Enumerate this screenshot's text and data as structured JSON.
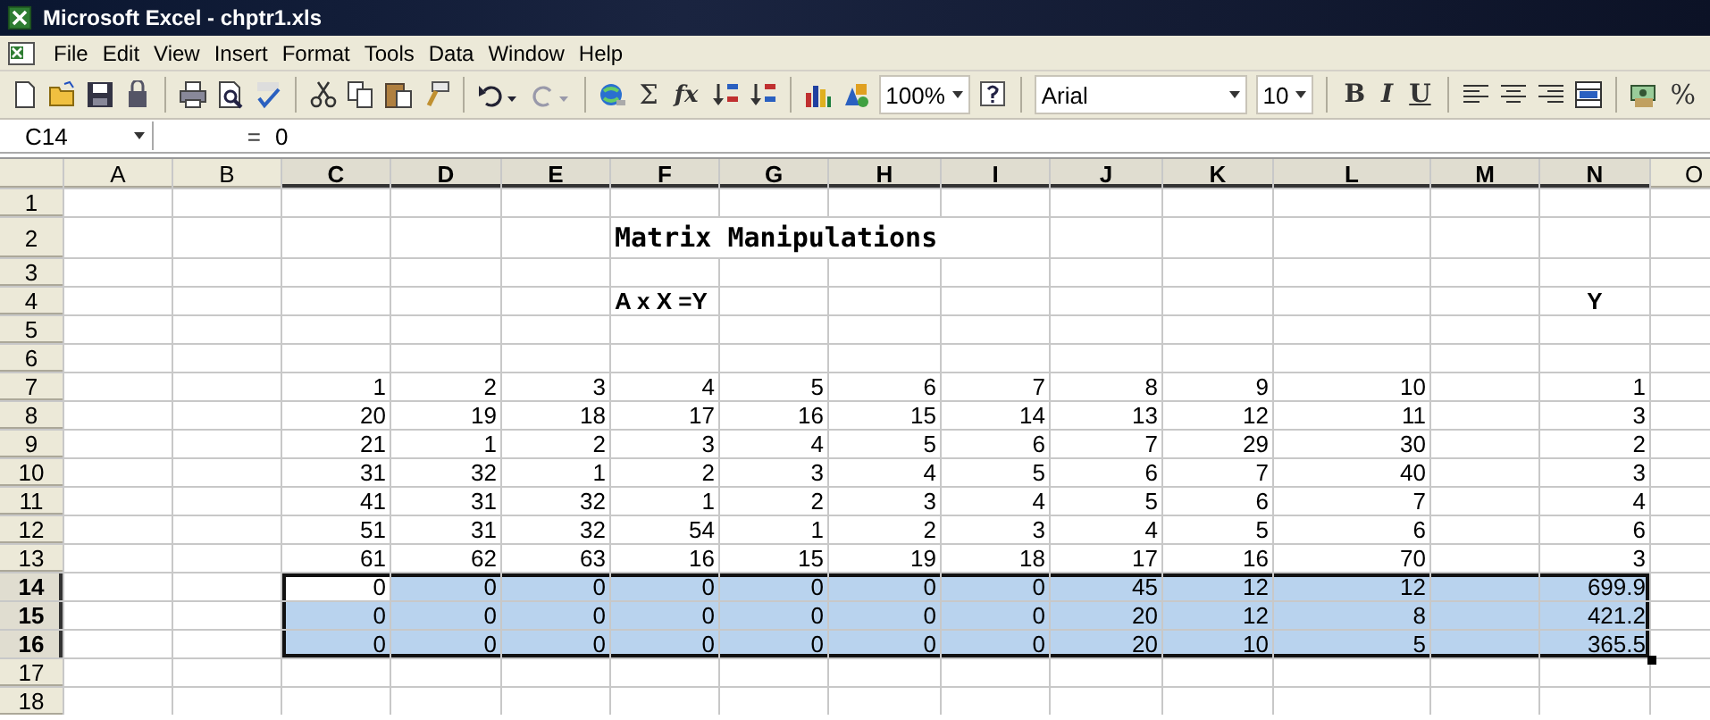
{
  "window": {
    "title": "Microsoft Excel - chptr1.xls"
  },
  "menu": [
    "File",
    "Edit",
    "View",
    "Insert",
    "Format",
    "Tools",
    "Data",
    "Window",
    "Help"
  ],
  "toolbar": [
    {
      "kind": "new"
    },
    {
      "kind": "open"
    },
    {
      "kind": "save"
    },
    {
      "kind": "permission"
    },
    {
      "kind": "separator"
    },
    {
      "kind": "print"
    },
    {
      "kind": "preview"
    },
    {
      "kind": "spelling"
    },
    {
      "kind": "separator"
    },
    {
      "kind": "cut"
    },
    {
      "kind": "copy"
    },
    {
      "kind": "paste"
    },
    {
      "kind": "painter"
    },
    {
      "kind": "separator"
    },
    {
      "kind": "undo"
    },
    {
      "kind": "redo"
    },
    {
      "kind": "separator"
    },
    {
      "kind": "hyperlink"
    },
    {
      "kind": "glyph",
      "text": "Σ"
    },
    {
      "kind": "function",
      "text": "fx"
    },
    {
      "kind": "sort-asc"
    },
    {
      "kind": "sort-desc"
    },
    {
      "kind": "separator"
    },
    {
      "kind": "chart"
    },
    {
      "kind": "drawing"
    },
    {
      "kind": "dropdown",
      "text": "100%"
    },
    {
      "kind": "help"
    },
    {
      "kind": "separator"
    },
    {
      "kind": "font",
      "text": "Arial"
    },
    {
      "kind": "dropdown",
      "text": "10"
    },
    {
      "kind": "separator"
    },
    {
      "kind": "bold",
      "text": "B"
    },
    {
      "kind": "italic",
      "text": "I"
    },
    {
      "kind": "underline",
      "text": "U"
    },
    {
      "kind": "separator"
    },
    {
      "kind": "align-left"
    },
    {
      "kind": "align-center"
    },
    {
      "kind": "align-right"
    },
    {
      "kind": "merge"
    },
    {
      "kind": "separator"
    },
    {
      "kind": "currency"
    },
    {
      "kind": "glyph",
      "text": "%"
    }
  ],
  "formula_bar": {
    "name_box": "C14",
    "equals": "=",
    "value": "0"
  },
  "columns": [
    {
      "label": "A",
      "selected": false
    },
    {
      "label": "B",
      "selected": false
    },
    {
      "label": "C",
      "selected": true
    },
    {
      "label": "D",
      "selected": true
    },
    {
      "label": "E",
      "selected": true
    },
    {
      "label": "F",
      "selected": true
    },
    {
      "label": "G",
      "selected": true
    },
    {
      "label": "H",
      "selected": true
    },
    {
      "label": "I",
      "selected": true
    },
    {
      "label": "J",
      "selected": true
    },
    {
      "label": "K",
      "selected": true
    },
    {
      "label": "L",
      "selected": true
    },
    {
      "label": "M",
      "selected": true
    },
    {
      "label": "N",
      "selected": true
    },
    {
      "label": "O",
      "selected": false
    }
  ],
  "rows": [
    {
      "number": "1",
      "selected": false,
      "cells": []
    },
    {
      "number": "2",
      "selected": false,
      "cells": [
        null,
        null,
        null,
        null,
        null,
        {
          "text": "Matrix Manipulations",
          "kind": "title"
        }
      ]
    },
    {
      "number": "3",
      "selected": false,
      "cells": []
    },
    {
      "number": "4",
      "selected": false,
      "cells": [
        null,
        null,
        null,
        null,
        null,
        {
          "text": "A x X =Y",
          "kind": "label"
        },
        null,
        null,
        null,
        null,
        null,
        null,
        null,
        {
          "text": "Y",
          "kind": "heading"
        }
      ]
    },
    {
      "number": "5",
      "selected": false,
      "cells": []
    },
    {
      "number": "6",
      "selected": false,
      "cells": []
    },
    {
      "number": "7",
      "selected": false,
      "values": [
        "1",
        "2",
        "3",
        "4",
        "5",
        "6",
        "7",
        "8",
        "9",
        "10",
        "1"
      ]
    },
    {
      "number": "8",
      "selected": false,
      "values": [
        "20",
        "19",
        "18",
        "17",
        "16",
        "15",
        "14",
        "13",
        "12",
        "11",
        "3"
      ]
    },
    {
      "number": "9",
      "selected": false,
      "values": [
        "21",
        "1",
        "2",
        "3",
        "4",
        "5",
        "6",
        "7",
        "29",
        "30",
        "2"
      ]
    },
    {
      "number": "10",
      "selected": false,
      "values": [
        "31",
        "32",
        "1",
        "2",
        "3",
        "4",
        "5",
        "6",
        "7",
        "40",
        "3"
      ]
    },
    {
      "number": "11",
      "selected": false,
      "values": [
        "41",
        "31",
        "32",
        "1",
        "2",
        "3",
        "4",
        "5",
        "6",
        "7",
        "4"
      ]
    },
    {
      "number": "12",
      "selected": false,
      "values": [
        "51",
        "31",
        "32",
        "54",
        "1",
        "2",
        "3",
        "4",
        "5",
        "6",
        "6"
      ]
    },
    {
      "number": "13",
      "selected": false,
      "values": [
        "61",
        "62",
        "63",
        "16",
        "15",
        "19",
        "18",
        "17",
        "16",
        "70",
        "3"
      ]
    },
    {
      "number": "14",
      "selected": true,
      "active": true,
      "values": [
        "0",
        "0",
        "0",
        "0",
        "0",
        "0",
        "0",
        "45",
        "12",
        "12",
        "699.9"
      ]
    },
    {
      "number": "15",
      "selected": true,
      "active": false,
      "values": [
        "0",
        "0",
        "0",
        "0",
        "0",
        "0",
        "0",
        "20",
        "12",
        "8",
        "421.2"
      ]
    },
    {
      "number": "16",
      "selected": true,
      "active": false,
      "values": [
        "0",
        "0",
        "0",
        "0",
        "0",
        "0",
        "0",
        "20",
        "10",
        "5",
        "365.5"
      ]
    },
    {
      "number": "17",
      "selected": false,
      "cells": []
    },
    {
      "number": "18",
      "selected": false,
      "cells": []
    }
  ]
}
